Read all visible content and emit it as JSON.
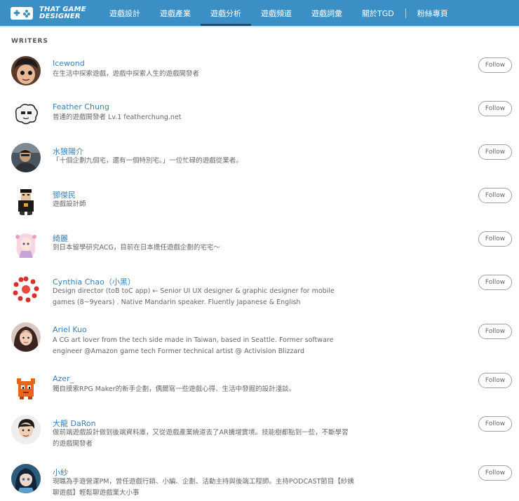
{
  "header": {
    "logo_line1": "THAT GAME",
    "logo_line2": "DESIGNER",
    "nav": [
      "遊戲設計",
      "遊戲產業",
      "遊戲分析",
      "遊戲頻道",
      "遊戲詞彙",
      "關於TGD",
      "粉絲專頁"
    ],
    "active_index": 2
  },
  "section_title": "WRITERS",
  "follow_label": "Follow",
  "writers": [
    {
      "name": "Icewond",
      "bio": "在生活中探索遊戲，遊戲中探索人生的遊戲開發者"
    },
    {
      "name": "Feather Chung",
      "bio": "普通的遊戲開發者 Lv.1 featherchung.net"
    },
    {
      "name": "水狼陽介",
      "bio": "「十個企劃九個宅，還有一個特別宅。」一位忙碌的遊戲從業者。"
    },
    {
      "name": "鄧傑民",
      "bio": "遊戲設計師"
    },
    {
      "name": "綺麗",
      "bio": "到日本留學研究ACG，目前在日本擔任遊戲企劃的宅宅～"
    },
    {
      "name": "Cynthia Chao（小黑）",
      "bio": "Design director (toB toC app) ← Senior UI UX designer & graphic designer for mobile games (8~9years) . Native Mandarin speaker. Fluently Japanese & English"
    },
    {
      "name": "Ariel Kuo",
      "bio": "A CG art lover from the tech side made in Taiwan, based in Seattle. Former software engineer @Amazon game tech Former technical artist @ Activision Blizzard"
    },
    {
      "name": "Azer_",
      "bio": "獨自摸索RPG Maker的新手企劃，偶爾寫一些遊戲心得、生活中發掘的設計淺談。"
    },
    {
      "name": "大龍 DaRon",
      "bio": "做前端遊戲設計做到後端資料庫，又從遊戲產業繞道去了AR擴增實境。技能樹都點到一些，不斷學習的遊戲開發者"
    },
    {
      "name": "小紗",
      "bio": "現職為手遊營運PM，曾任遊戲行銷、小編、企劃、活動主持與後端工程師。主持PODCAST節目【紗姨聊遊戲】輕鬆聊遊戲業大小事"
    }
  ]
}
